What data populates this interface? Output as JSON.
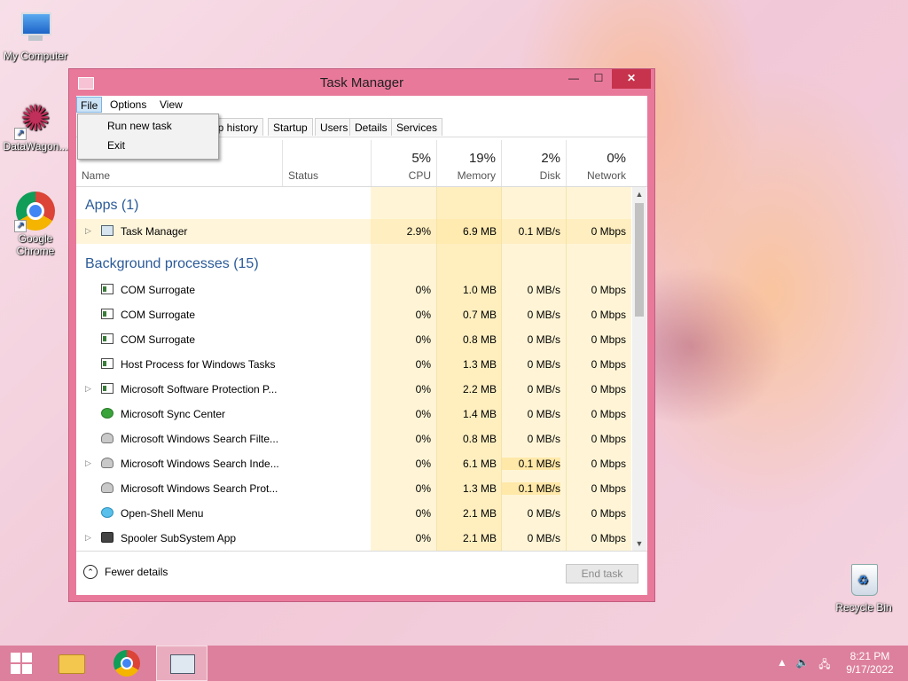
{
  "desktop": {
    "icons": [
      {
        "label": "My Computer"
      },
      {
        "label": "DataWagon..."
      },
      {
        "label": "Google Chrome"
      },
      {
        "label": "Recycle Bin"
      }
    ]
  },
  "window": {
    "title": "Task Manager",
    "controls": {
      "minimize": "—",
      "maximize": "☐",
      "close": "✕"
    }
  },
  "menubar": {
    "items": [
      {
        "label": "File",
        "active": true
      },
      {
        "label": "Options"
      },
      {
        "label": "View"
      }
    ]
  },
  "file_menu": {
    "items": [
      {
        "label": "Run new task"
      },
      {
        "label": "Exit"
      }
    ]
  },
  "tabs": {
    "items": [
      {
        "label": "pp history"
      },
      {
        "label": "Startup"
      },
      {
        "label": "Users"
      },
      {
        "label": "Details"
      },
      {
        "label": "Services"
      }
    ]
  },
  "columns": {
    "name": "Name",
    "status": "Status",
    "cpu": {
      "percent": "5%",
      "label": "CPU"
    },
    "memory": {
      "percent": "19%",
      "label": "Memory"
    },
    "disk": {
      "percent": "2%",
      "label": "Disk"
    },
    "network": {
      "percent": "0%",
      "label": "Network"
    }
  },
  "groups": {
    "apps": {
      "title": "Apps (1)",
      "rows": [
        {
          "name": "Task Manager",
          "icon": "task-manager-icon",
          "expandable": true,
          "cpu": "2.9%",
          "memory": "6.9 MB",
          "disk": "0.1 MB/s",
          "network": "0 Mbps"
        }
      ]
    },
    "background": {
      "title": "Background processes (15)",
      "rows": [
        {
          "name": "COM Surrogate",
          "icon": "generic-process-icon",
          "expandable": false,
          "cpu": "0%",
          "memory": "1.0 MB",
          "disk": "0 MB/s",
          "network": "0 Mbps"
        },
        {
          "name": "COM Surrogate",
          "icon": "generic-process-icon",
          "expandable": false,
          "cpu": "0%",
          "memory": "0.7 MB",
          "disk": "0 MB/s",
          "network": "0 Mbps"
        },
        {
          "name": "COM Surrogate",
          "icon": "generic-process-icon",
          "expandable": false,
          "cpu": "0%",
          "memory": "0.8 MB",
          "disk": "0 MB/s",
          "network": "0 Mbps"
        },
        {
          "name": "Host Process for Windows Tasks",
          "icon": "generic-process-icon",
          "expandable": false,
          "cpu": "0%",
          "memory": "1.3 MB",
          "disk": "0 MB/s",
          "network": "0 Mbps"
        },
        {
          "name": "Microsoft Software Protection P...",
          "icon": "generic-process-icon",
          "expandable": true,
          "cpu": "0%",
          "memory": "2.2 MB",
          "disk": "0 MB/s",
          "network": "0 Mbps"
        },
        {
          "name": "Microsoft Sync Center",
          "icon": "sync-center-icon",
          "expandable": false,
          "cpu": "0%",
          "memory": "1.4 MB",
          "disk": "0 MB/s",
          "network": "0 Mbps"
        },
        {
          "name": "Microsoft Windows Search Filte...",
          "icon": "search-process-icon",
          "expandable": false,
          "cpu": "0%",
          "memory": "0.8 MB",
          "disk": "0 MB/s",
          "network": "0 Mbps"
        },
        {
          "name": "Microsoft Windows Search Inde...",
          "icon": "search-process-icon",
          "expandable": true,
          "cpu": "0%",
          "memory": "6.1 MB",
          "disk": "0.1 MB/s",
          "network": "0 Mbps"
        },
        {
          "name": "Microsoft Windows Search Prot...",
          "icon": "search-process-icon",
          "expandable": false,
          "cpu": "0%",
          "memory": "1.3 MB",
          "disk": "0.1 MB/s",
          "network": "0 Mbps"
        },
        {
          "name": "Open-Shell Menu",
          "icon": "open-shell-icon",
          "expandable": false,
          "cpu": "0%",
          "memory": "2.1 MB",
          "disk": "0 MB/s",
          "network": "0 Mbps"
        },
        {
          "name": "Spooler SubSystem App",
          "icon": "printer-icon",
          "expandable": true,
          "cpu": "0%",
          "memory": "2.1 MB",
          "disk": "0 MB/s",
          "network": "0 Mbps"
        }
      ]
    }
  },
  "footer": {
    "fewer_details": "Fewer details",
    "end_task": "End task"
  },
  "taskbar": {
    "clock_time": "8:21 PM",
    "clock_date": "9/17/2022"
  },
  "colors": {
    "window_frame": "#e9799b",
    "close_button": "#c7334c",
    "taskbar": "#dd809d",
    "group_title": "#2a5a98",
    "heat_light": "#fff5d6",
    "heat_medium": "#ffefbf",
    "heat_strong": "#ffe8a8"
  }
}
